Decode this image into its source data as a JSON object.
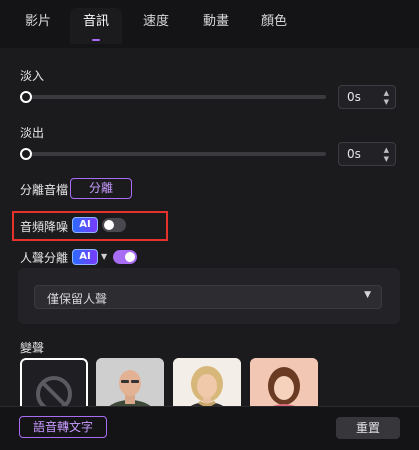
{
  "tabs": [
    {
      "label": "影片",
      "active": false
    },
    {
      "label": "音訊",
      "active": true
    },
    {
      "label": "速度",
      "active": false
    },
    {
      "label": "動畫",
      "active": false
    },
    {
      "label": "顏色",
      "active": false
    }
  ],
  "fade_in": {
    "label": "淡入",
    "value": "0s",
    "level": 0
  },
  "fade_out": {
    "label": "淡出",
    "value": "0s",
    "level": 0
  },
  "separate_audio": {
    "label": "分離音檔",
    "button_label": "分離"
  },
  "denoise": {
    "label": "音頻降噪",
    "ai_badge": "AI",
    "enabled": false
  },
  "vocal_separation": {
    "label": "人聲分離",
    "ai_badge": "AI",
    "enabled": true,
    "option": "僅保留人聲"
  },
  "voice_changer": {
    "label": "變聲",
    "presets": [
      "none-icon",
      "bald-man-avatar",
      "blonde-woman-avatar",
      "girl-avatar"
    ]
  },
  "footer": {
    "speech_to_text_label": "語音轉文字",
    "reset_label": "重置"
  },
  "colors": {
    "accent": "#a96cf5",
    "highlight": "#e5322d",
    "background": "#1b1b1e"
  }
}
